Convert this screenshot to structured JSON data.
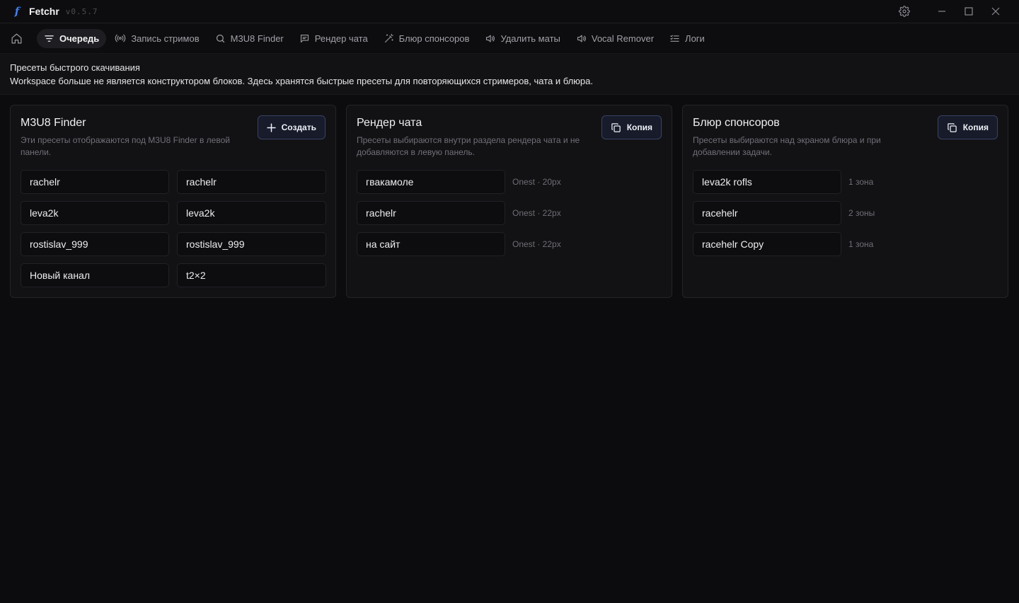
{
  "app": {
    "name": "Fetchr",
    "version": "v0.5.7",
    "logo_letter": "f",
    "accent": "#3b82f6"
  },
  "tabs": [
    {
      "label": "Очередь",
      "icon": "filter-lines-icon",
      "active": true
    },
    {
      "label": "Запись стримов",
      "icon": "broadcast-icon"
    },
    {
      "label": "M3U8 Finder",
      "icon": "search-icon"
    },
    {
      "label": "Рендер чата",
      "icon": "chat-icon"
    },
    {
      "label": "Блюр спонсоров",
      "icon": "magic-wand-icon"
    },
    {
      "label": "Удалить маты",
      "icon": "speaker-icon"
    },
    {
      "label": "Vocal Remover",
      "icon": "speaker-icon"
    },
    {
      "label": "Логи",
      "icon": "list-checks-icon"
    }
  ],
  "banner": {
    "title": "Пресеты быстрого скачивания",
    "text": "Workspace больше не является конструктором блоков. Здесь хранятся быстрые пресеты для повторяющихся стримеров, чата и блюра."
  },
  "cards": {
    "m3u8": {
      "title": "M3U8 Finder",
      "description": "Эти пресеты отображаются под M3U8 Finder в левой панели.",
      "button": "Создать",
      "presets": [
        "rachelr",
        "rachelr",
        "leva2k",
        "leva2k",
        "rostislav_999",
        "rostislav_999",
        "Новый канал",
        "t2×2"
      ]
    },
    "chat": {
      "title": "Рендер чата",
      "description": "Пресеты выбираются внутри раздела рендера чата и не добавляются в левую панель.",
      "button": "Копия",
      "presets": [
        {
          "name": "гвакамоле",
          "meta": "Onest · 20px"
        },
        {
          "name": "rachelr",
          "meta": "Onest · 22px"
        },
        {
          "name": "на сайт",
          "meta": "Onest · 22px"
        }
      ]
    },
    "blur": {
      "title": "Блюр спонсоров",
      "description": "Пресеты выбираются над экраном блюра и при добавлении задачи.",
      "button": "Копия",
      "presets": [
        {
          "name": "leva2k rofls",
          "meta": "1 зона"
        },
        {
          "name": "racehelr",
          "meta": "2 зоны"
        },
        {
          "name": "racehelr Copy",
          "meta": "1 зона"
        }
      ]
    }
  }
}
